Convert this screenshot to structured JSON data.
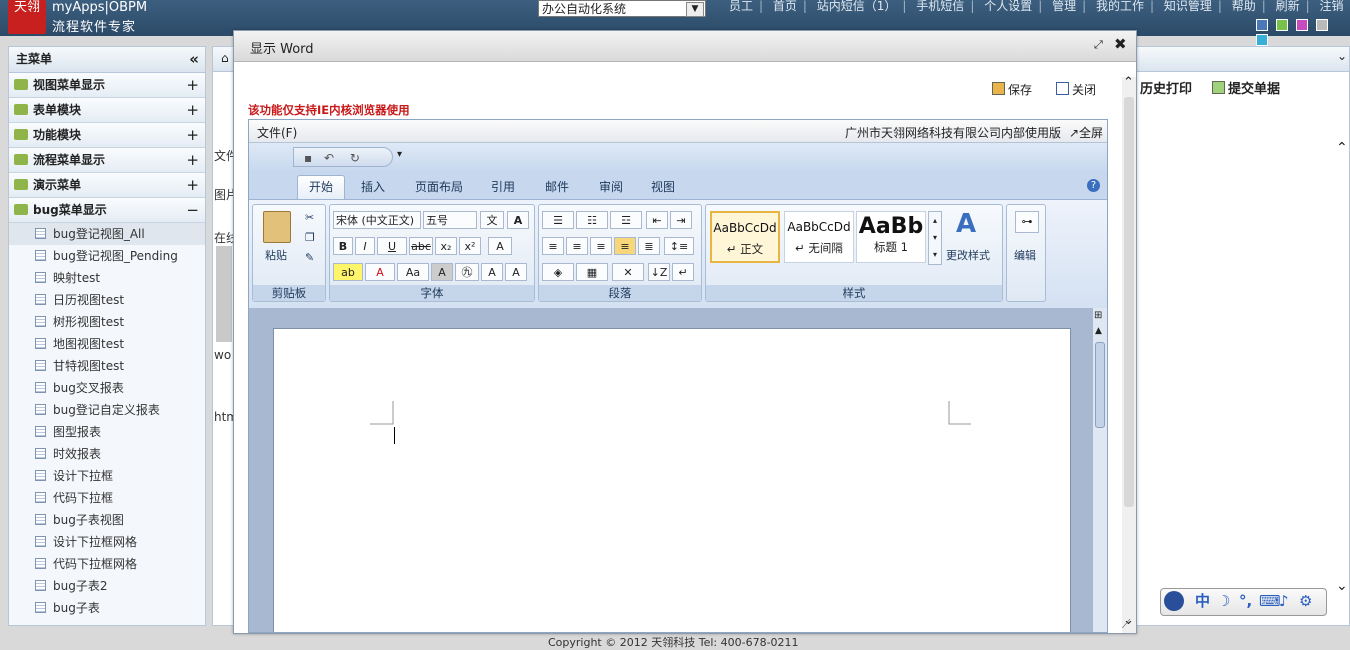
{
  "header": {
    "logo_text": "天翎",
    "app_name": "myApps|OBPM",
    "app_subtitle": "流程软件专家",
    "system_select": "办公自动化系统",
    "nav": [
      "员工",
      "首页",
      "站内短信（1）",
      "手机短信",
      "个人设置",
      "管理",
      "我的工作",
      "知识管理",
      "帮助",
      "刷新",
      "注销"
    ],
    "theme_colors": [
      "#4a78b8",
      "#79c24a",
      "#c84ac0",
      "#b9b9b9",
      "#37b0d8"
    ]
  },
  "sidebar": {
    "title": "主菜单",
    "collapse_symbol": "«",
    "sections": [
      {
        "label": "视图菜单显示",
        "toggle": "+"
      },
      {
        "label": "表单模块",
        "toggle": "+"
      },
      {
        "label": "功能模块",
        "toggle": "+"
      },
      {
        "label": "流程菜单显示",
        "toggle": "+"
      },
      {
        "label": "演示菜单",
        "toggle": "+"
      },
      {
        "label": "bug菜单显示",
        "toggle": "−"
      }
    ],
    "items": [
      "bug登记视图_All",
      "bug登记视图_Pending",
      "映射test",
      "日历视图test",
      "树形视图test",
      "地图视图test",
      "甘特视图test",
      "bug交叉报表",
      "bug登记自定义报表",
      "图型报表",
      "时效报表",
      "设计下拉框",
      "代码下拉框",
      "bug子表视图",
      "设计下拉框网格",
      "代码下拉框网格",
      "bug子表2",
      "bug子表"
    ]
  },
  "background": {
    "history_print": "历史打印",
    "submit_form": "提交单据",
    "frag_file": "文件",
    "frag_image": "图片",
    "frag_online": "在线",
    "frag_wo": "wo",
    "frag_htm": "htm",
    "footer": "Copyright © 2012 天翎科技 Tel: 400-678-0211"
  },
  "dialog": {
    "title": "显示 Word",
    "maximize": "⤢",
    "close": "✖",
    "save_label": "保存",
    "close_label": "关闭",
    "warning": "该功能仅支持IE内核浏览器使用"
  },
  "word": {
    "file_menu": "文件(F)",
    "company": "广州市天翎网络科技有限公司内部使用版",
    "fullscreen": "↗全屏",
    "tabs": [
      "开始",
      "插入",
      "页面布局",
      "引用",
      "邮件",
      "审阅",
      "视图"
    ],
    "groups": {
      "clipboard": "剪贴板",
      "font": "字体",
      "paragraph": "段落",
      "styles": "样式",
      "editing": "编辑"
    },
    "paste_label": "粘贴",
    "font_name": "宋体 (中文正文)",
    "font_size": "五号",
    "styles": [
      {
        "sample": "AaBbCcDd",
        "name": "↵ 正文"
      },
      {
        "sample": "AaBbCcDd",
        "name": "↵ 无间隔"
      },
      {
        "sample": "AaBb",
        "name": "标题 1"
      }
    ],
    "change_styles": "更改样式"
  },
  "ime": {
    "label": "中"
  }
}
